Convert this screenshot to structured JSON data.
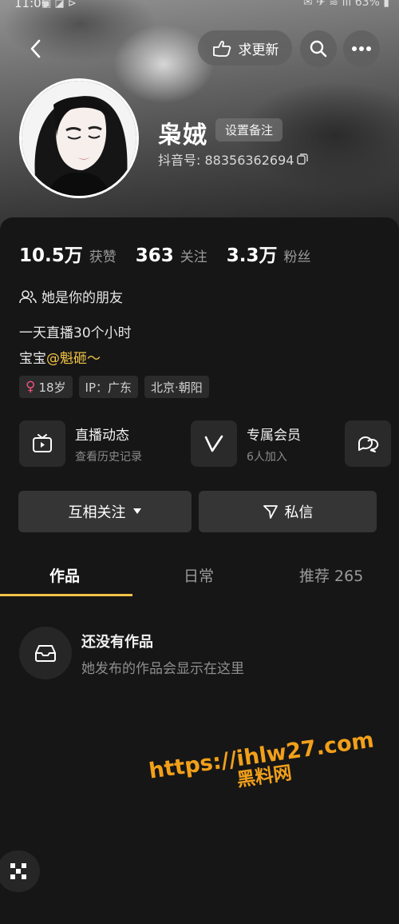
{
  "status_bar": {
    "time": "11:06",
    "battery": "63%"
  },
  "header": {
    "follow_update_label": "求更新"
  },
  "profile": {
    "name": "枭娀",
    "remark_label": "设置备注",
    "douyin_id": "抖音号: 88356362694"
  },
  "stats": [
    {
      "value": "10.5万",
      "label": "获赞"
    },
    {
      "value": "363",
      "label": "关注"
    },
    {
      "value": "3.3万",
      "label": "粉丝"
    }
  ],
  "relation": "她是你的朋友",
  "bio": {
    "line1": "一天直播30个小时",
    "line2_prefix": "宝宝",
    "mention": "@魁砸～"
  },
  "tags": {
    "age": "18岁",
    "ip": "IP：广东",
    "location": "北京·朝阳"
  },
  "features": [
    {
      "title": "直播动态",
      "subtitle": "查看历史记录"
    },
    {
      "title": "专属会员",
      "subtitle": "6人加入"
    }
  ],
  "actions": {
    "mutual_follow": "互相关注",
    "message": "私信"
  },
  "tabs": [
    {
      "label": "作品",
      "active": true
    },
    {
      "label": "日常",
      "active": false
    },
    {
      "label": "推荐 265",
      "active": false
    }
  ],
  "empty_state": {
    "title": "还没有作品",
    "subtitle": "她发布的作品会显示在这里"
  },
  "watermark": {
    "url": "https://ihlw27.com",
    "name": "黑料网"
  },
  "colors": {
    "accent": "#f1c346",
    "background": "#161616",
    "watermark": "#f2a01a"
  }
}
